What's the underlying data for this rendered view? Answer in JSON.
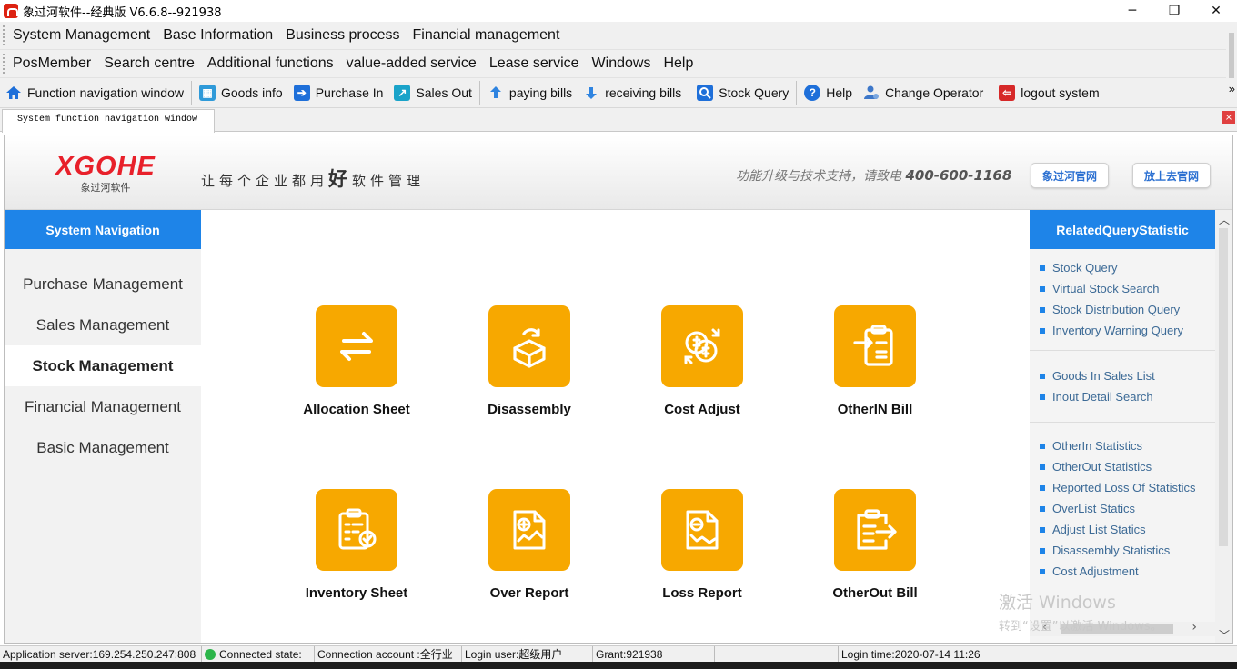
{
  "window": {
    "title": "象过河软件--经典版 V6.6.8--921938",
    "min_icon": "minimize-icon",
    "max_icon": "maximize-icon",
    "close_icon": "close-icon"
  },
  "menu_row1": [
    "System Management",
    "Base Information",
    "Business process",
    "Financial management"
  ],
  "menu_row2": [
    "PosMember",
    "Search centre",
    "Additional functions",
    "value-added service",
    "Lease service",
    "Windows",
    "Help"
  ],
  "toolbar": [
    {
      "label": "Function navigation window",
      "icon": "home-icon",
      "color": "#1e6fd9"
    },
    {
      "label": "Goods info",
      "icon": "goods-icon",
      "color": "#2f9ad9"
    },
    {
      "label": "Purchase In",
      "icon": "purchase-icon",
      "color": "#1e6fd9"
    },
    {
      "label": "Sales Out",
      "icon": "sales-icon",
      "color": "#1aa3c9"
    },
    {
      "label": "paying bills",
      "icon": "upload-icon",
      "color": "#2f84e0"
    },
    {
      "label": "receiving bills",
      "icon": "download-icon",
      "color": "#2f84e0"
    },
    {
      "label": "Stock Query",
      "icon": "search-icon",
      "color": "#1e6fd9"
    },
    {
      "label": "Help",
      "icon": "help-icon",
      "color": "#1e6fd9"
    },
    {
      "label": "Change  Operator",
      "icon": "user-switch-icon",
      "color": "#3d77c9"
    },
    {
      "label": "logout  system",
      "icon": "logout-icon",
      "color": "#d62828"
    }
  ],
  "toolbar_overflow": "»",
  "tab": {
    "label": "System function navigation window",
    "close": "×"
  },
  "banner": {
    "brand": "XGOHE",
    "brand_sub": "象过河软件",
    "slogan_pre": "让每个企业都用",
    "slogan_big": "好",
    "slogan_post": "软件管理",
    "hotline_text": "功能升级与技术支持，请致电",
    "hotline_number": "400-600-1168",
    "btn1": "象过河官网",
    "btn2": "放上去官网"
  },
  "left_nav": {
    "header": "System Navigation",
    "items": [
      "Purchase Management",
      "Sales Management",
      "Stock Management",
      "Financial Management",
      "Basic Management"
    ],
    "active_index": 2
  },
  "cards": [
    {
      "label": "Allocation Sheet",
      "icon": "swap-arrows-icon"
    },
    {
      "label": "Disassembly",
      "icon": "box-open-icon"
    },
    {
      "label": "Cost Adjust",
      "icon": "coins-exchange-icon"
    },
    {
      "label": "OtherIN Bill",
      "icon": "clipboard-in-icon"
    },
    {
      "label": "Inventory Sheet",
      "icon": "clipboard-check-icon"
    },
    {
      "label": "Over Report",
      "icon": "document-plus-icon"
    },
    {
      "label": "Loss Report",
      "icon": "document-minus-icon"
    },
    {
      "label": "OtherOut Bill",
      "icon": "clipboard-out-icon"
    }
  ],
  "right_panel": {
    "header": "RelatedQueryStatistic",
    "groups": [
      [
        "Stock Query",
        "Virtual Stock Search",
        "Stock Distribution Query",
        "Inventory Warning Query"
      ],
      [
        "Goods In Sales List",
        "Inout Detail Search"
      ],
      [
        "OtherIn Statistics",
        "OtherOut Statistics",
        "Reported Loss Of Statistics",
        "OverList Statics",
        "Adjust List Statics",
        "Disassembly Statistics",
        "Cost Adjustment"
      ]
    ]
  },
  "watermark": {
    "line1": "激活 Windows",
    "line2": "转到“设置”以激活 Windows。"
  },
  "status": {
    "server": "Application server:169.254.250.247:808",
    "connected": "Connected state:",
    "account": "Connection account :全行业",
    "login_user": "Login user:超级用户",
    "grant": "Grant:921938",
    "blank": "",
    "login_time": "Login time:2020-07-14 11:26"
  },
  "colors": {
    "accent_blue": "#1e84e8",
    "tile_orange": "#f7a800",
    "brand_red": "#e8202a",
    "status_green": "#2cb54a"
  }
}
